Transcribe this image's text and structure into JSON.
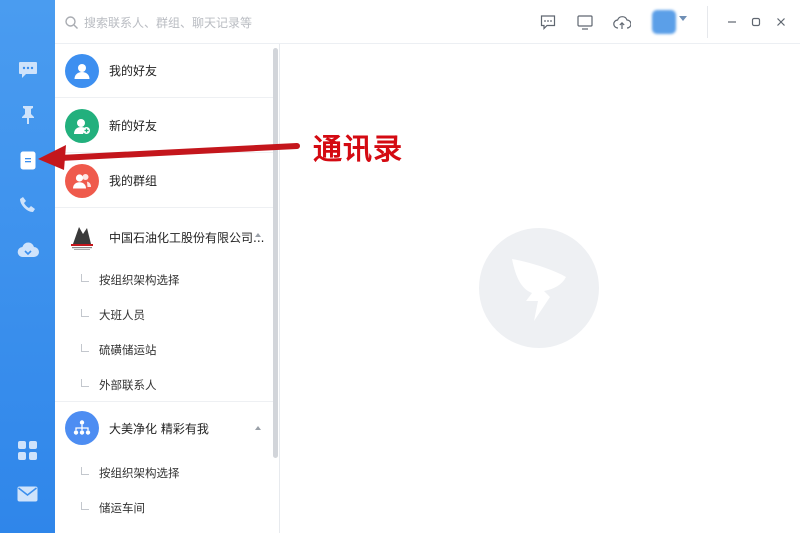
{
  "search": {
    "placeholder": "搜索联系人、群组、聊天记录等",
    "icon": "search-icon"
  },
  "rail": {
    "color": "#3b8fee",
    "items": [
      {
        "icon": "chat-icon",
        "active": false
      },
      {
        "icon": "pin-icon",
        "active": false
      },
      {
        "icon": "contacts-icon",
        "active": true
      },
      {
        "icon": "phone-icon",
        "active": false
      },
      {
        "icon": "cloud-disk-icon",
        "active": false
      },
      {
        "icon": "apps-grid-icon",
        "active": false
      },
      {
        "icon": "mail-icon",
        "active": false
      }
    ]
  },
  "toolbar": {
    "icons": [
      "message-icon",
      "screen-icon",
      "cloud-upload-icon"
    ],
    "window": [
      "minimize-icon",
      "maximize-icon",
      "close-icon"
    ]
  },
  "contacts": {
    "my_friends": "我的好友",
    "new_friends": "新的好友",
    "my_groups": "我的群组",
    "org1": {
      "name": "中国石油化工股份有限公司...",
      "children": [
        "按组织架构选择",
        "大班人员",
        "硫磺储运站",
        "外部联系人"
      ]
    },
    "org2": {
      "name": "大美净化 精彩有我",
      "children": [
        "按组织架构选择",
        "储运车间"
      ]
    }
  },
  "annotation": {
    "text": "通讯录",
    "color": "#d40a12"
  },
  "colors": {
    "friends": "#3d8ff0",
    "new_friends": "#22b07d",
    "groups": "#ef5a4c",
    "org2": "#4d8df2"
  }
}
